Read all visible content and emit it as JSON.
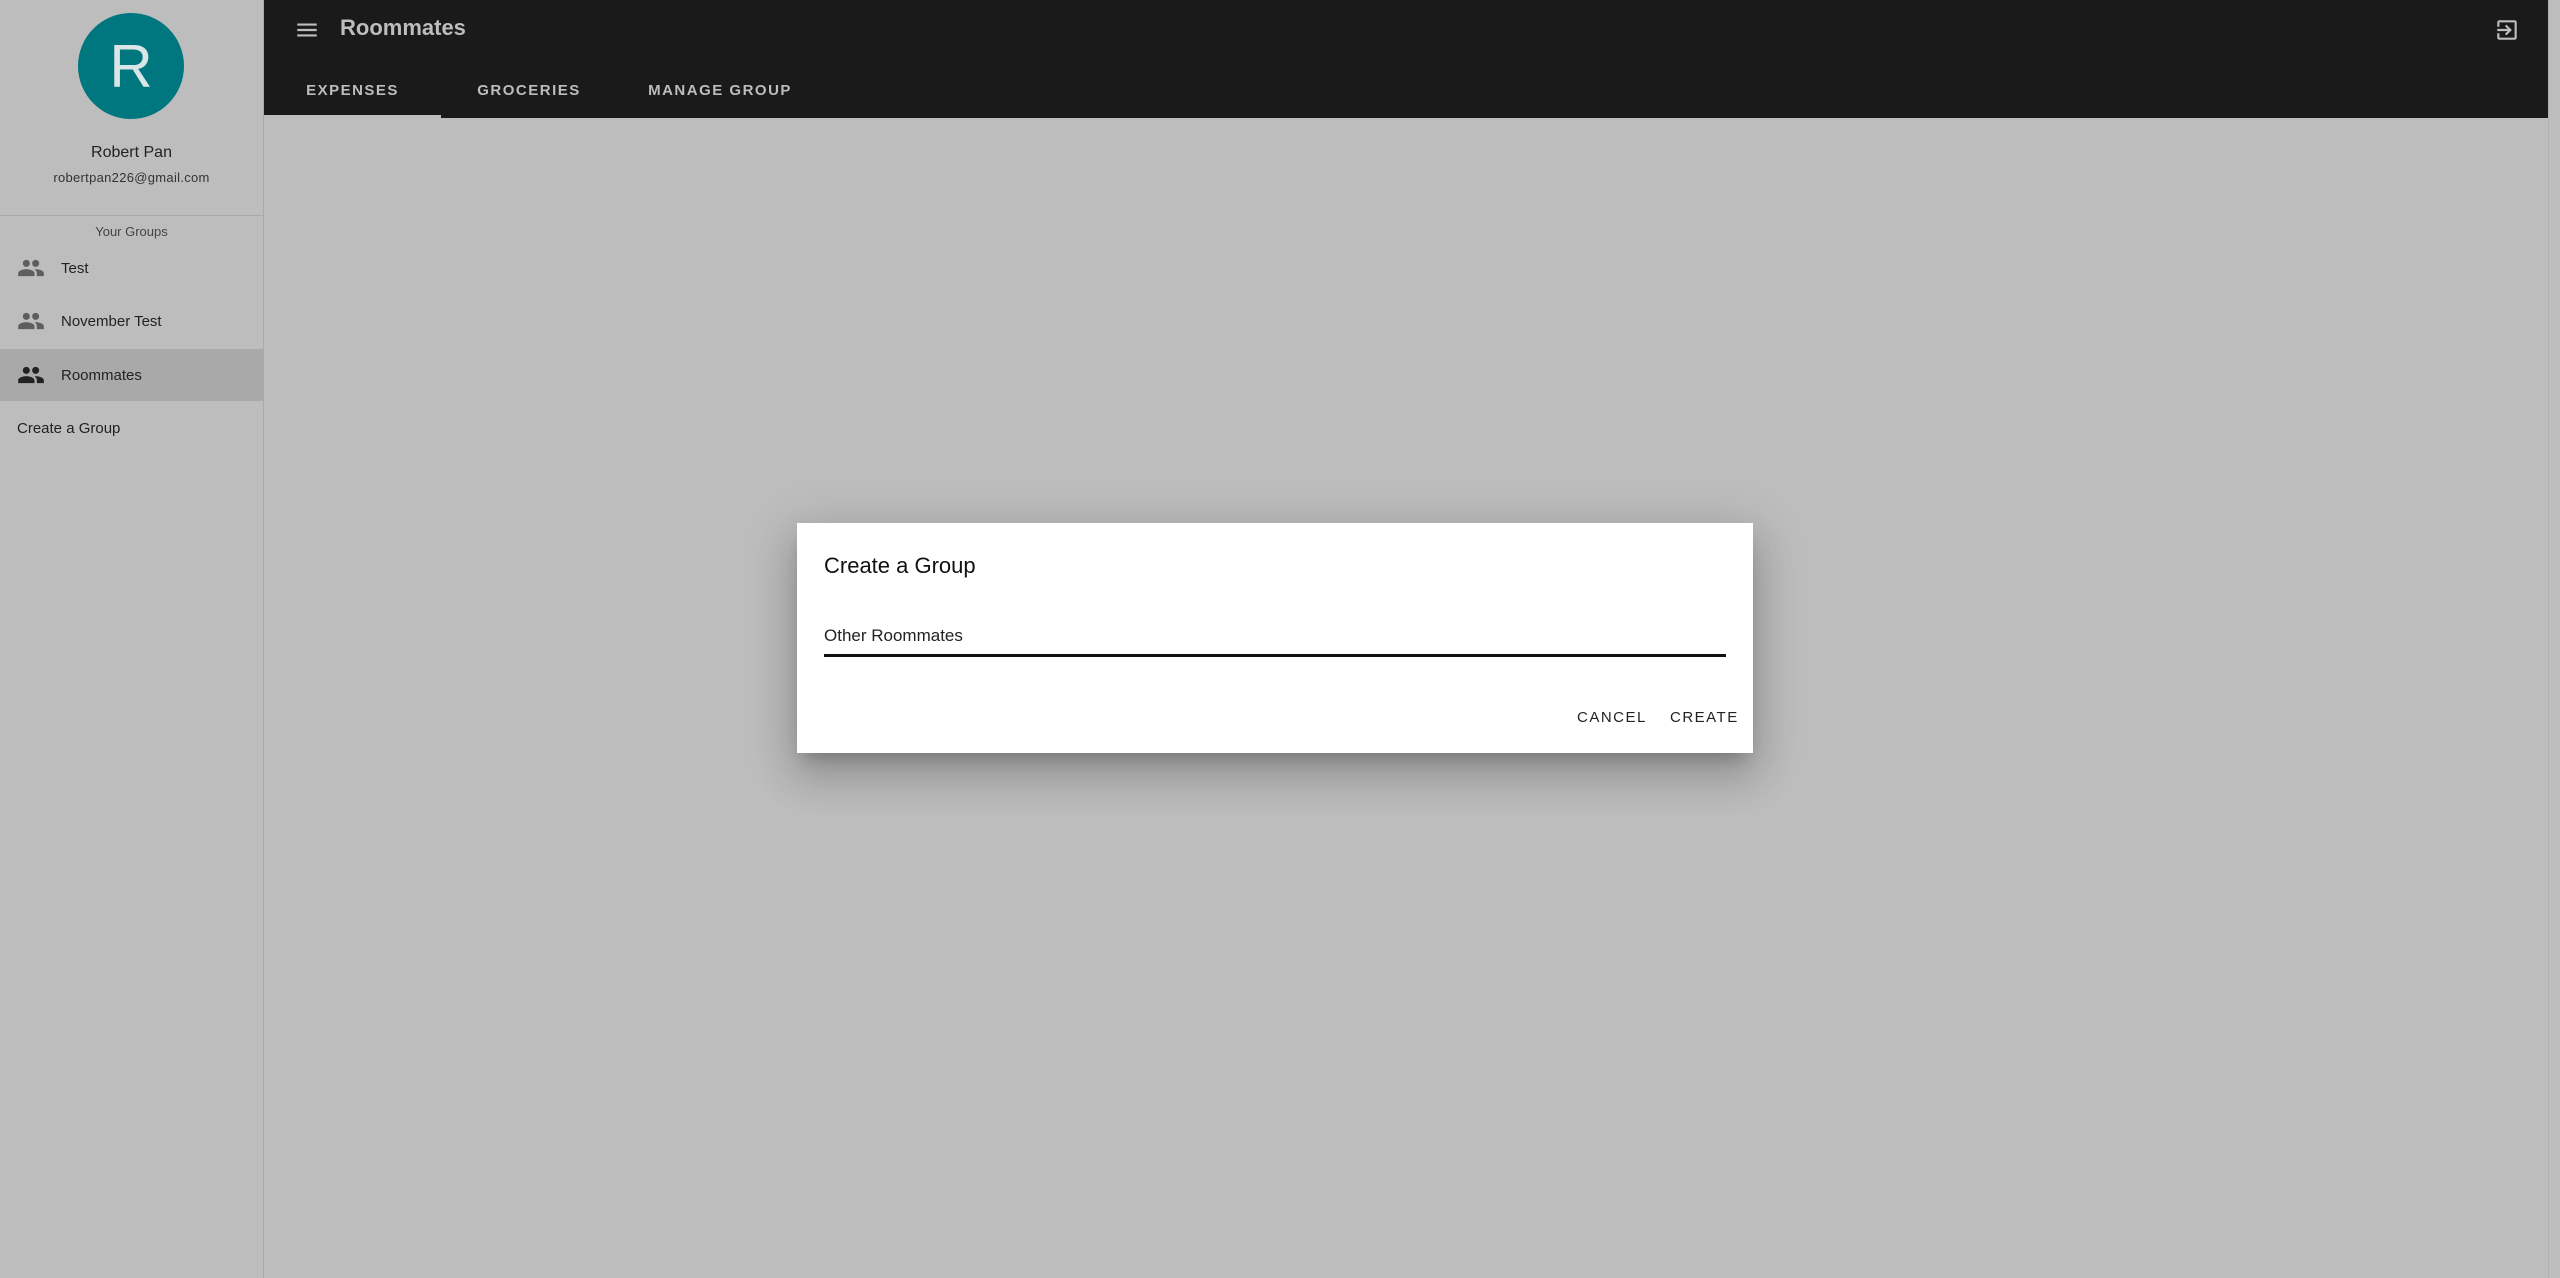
{
  "user": {
    "avatar_letter": "R",
    "name": "Robert Pan",
    "email": "robertpan226@gmail.com"
  },
  "sidebar": {
    "groups_header": "Your Groups",
    "items": [
      {
        "label": "Test",
        "icon": "people-icon"
      },
      {
        "label": "November Test",
        "icon": "people-icon"
      },
      {
        "label": "Roommates",
        "icon": "people-icon",
        "active": true
      }
    ],
    "create_group_label": "Create a Group"
  },
  "appbar": {
    "title": "Roommates",
    "menu_icon": "menu-icon",
    "exit_icon": "exit-to-app-icon",
    "tabs": [
      {
        "label": "EXPENSES",
        "active": true
      },
      {
        "label": "GROCERIES"
      },
      {
        "label": "MANAGE GROUP"
      }
    ]
  },
  "dialog": {
    "title": "Create a Group",
    "input_value": "Other Roommates",
    "cancel_label": "CANCEL",
    "create_label": "CREATE"
  },
  "colors": {
    "avatar_bg": "#00767f",
    "appbar_bg": "#1a1a1a",
    "overlay_bg": "#bdbdbd"
  }
}
